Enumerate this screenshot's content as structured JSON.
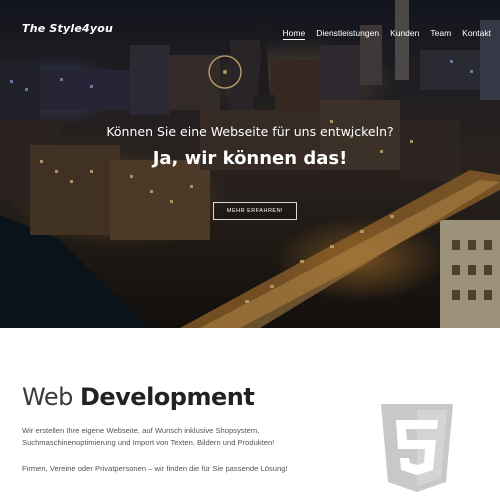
{
  "brand": {
    "name": "The Style4you"
  },
  "nav": {
    "items": [
      {
        "label": "Home"
      },
      {
        "label": "Dienstleistungen"
      },
      {
        "label": "Kunden"
      },
      {
        "label": "Team"
      },
      {
        "label": "Kontakt"
      }
    ]
  },
  "hero": {
    "subtitle": "Können Sie eine Webseite für uns entwickeln?",
    "title": "Ja, wir können das!",
    "button_label": "MEHR ERFAHREN!"
  },
  "section": {
    "title_light": "Web ",
    "title_bold": "Development",
    "paragraph1": "Wir erstellen Ihre eigene Webseite, auf Wunsch inklusive Shopsystem, Suchmaschinenoptimierung und Import von Texten, Bildern und Produkten!",
    "paragraph2": "Firmen, Vereine oder Privatpersonen – wir finden die für Sie passende Lösung!",
    "icon": "html5-icon"
  },
  "colors": {
    "hero_text": "#ffffff",
    "heading": "#222222",
    "body_text": "#555555",
    "icon_gray": "#c8c8c8"
  }
}
